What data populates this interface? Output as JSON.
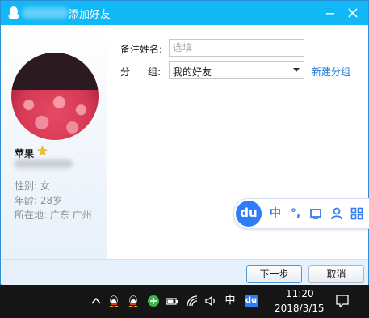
{
  "window": {
    "title": "添加好友",
    "title_prefix_obscured": "",
    "accent_color": "#12b7f5"
  },
  "profile": {
    "nickname": "苹果",
    "gender_line": "性别: 女",
    "age_line": "年龄: 28岁",
    "location_line": "所在地: 广东  广州"
  },
  "form": {
    "remark_label": "备注姓名:",
    "remark_placeholder": "选填",
    "remark_value": "",
    "group_label_1": "分",
    "group_label_2": "组:",
    "group_selected": "我的好友",
    "new_group_link": "新建分组"
  },
  "ime": {
    "logo": "du",
    "mode_label": "中",
    "punct_label": "°,",
    "icons": [
      "shirt-icon",
      "user-icon",
      "grid-icon"
    ]
  },
  "buttons": {
    "next_label": "下一步",
    "cancel_label": "取消"
  },
  "taskbar": {
    "ime_indicator": "中",
    "ime_app_label": "du",
    "time": "11:20",
    "date": "2018/3/15"
  }
}
